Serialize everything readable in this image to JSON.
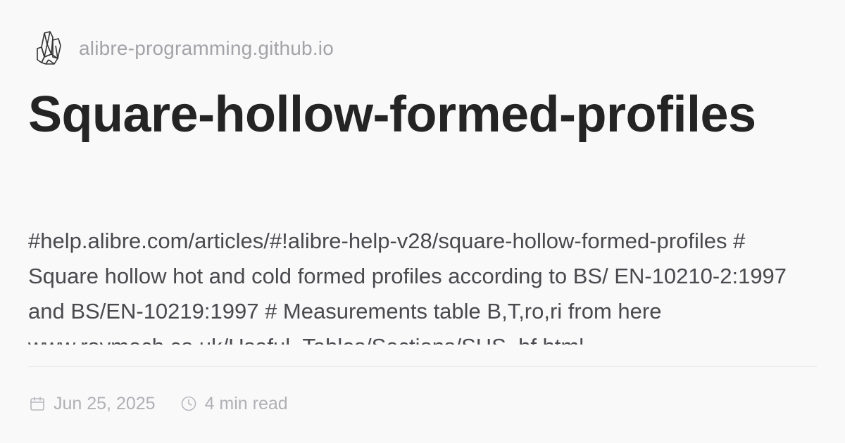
{
  "site": {
    "logo_icon": "crystal-logo-icon",
    "name": "alibre-programming.github.io"
  },
  "post": {
    "title": "Square-hollow-formed-profiles",
    "description": "#help.alibre.com/articles/#!alibre-help-v28/square-hollow-formed-profiles # Square hollow hot and cold formed profiles according to BS/ EN-10210-2:1997 and BS/EN-10219:1997 # Measurements table B,T,ro,ri from here www.roymech.co.uk/Useful_Tables/Sections/SHS_hf.html"
  },
  "meta": {
    "date_icon": "calendar-icon",
    "date": "Jun 25, 2025",
    "reading_icon": "clock-icon",
    "reading_time": "4 min read"
  },
  "colors": {
    "background": "#f9f9fa",
    "title": "#242424",
    "description": "#4a4a4e",
    "muted": "#a3a3a8"
  }
}
